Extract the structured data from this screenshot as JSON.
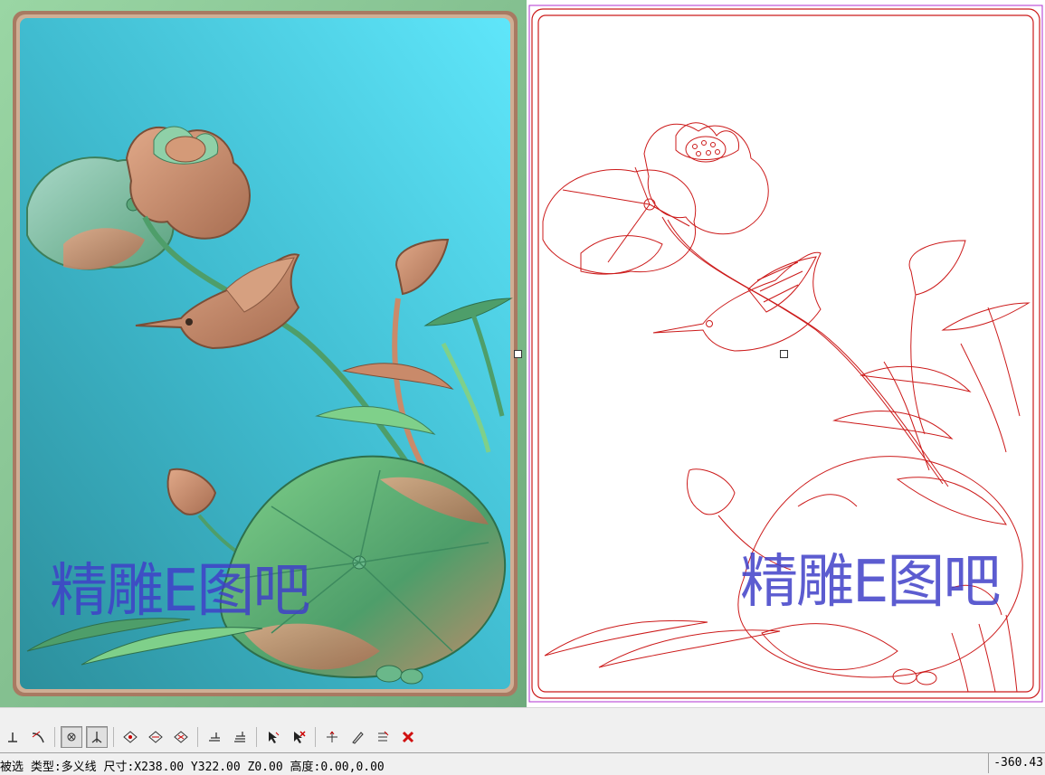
{
  "watermark": {
    "left_text": "精雕E图吧",
    "right_text": "精雕E图吧"
  },
  "colors": {
    "relief_frame": "#8fc89a",
    "relief_background_top": "#5fe0f8",
    "relief_background_bottom": "#2f9aa6",
    "copper": "#c98a6a",
    "jade_green": "#4fa06a",
    "vector_lines": "#cc1a1a",
    "selection_outline": "#b030d0",
    "watermark": "#4040c8"
  },
  "toolbar": {
    "buttons": [
      {
        "icon": "perpendicular-snap-icon"
      },
      {
        "icon": "tangent-snap-icon"
      },
      {
        "icon": "snap-toggle-icon",
        "pressed": true
      },
      {
        "icon": "ortho-toggle-icon",
        "pressed": true
      },
      {
        "icon": "diamond-node-icon"
      },
      {
        "icon": "diamond-node-alt-icon"
      },
      {
        "icon": "diamond-node-cross-icon"
      },
      {
        "icon": "layer-flat-icon"
      },
      {
        "icon": "layer-stack-icon"
      },
      {
        "icon": "select-arrow-icon"
      },
      {
        "icon": "deselect-arrow-icon"
      },
      {
        "icon": "transform-arrow-icon"
      },
      {
        "icon": "pick-pen-icon"
      },
      {
        "icon": "list-edit-icon"
      },
      {
        "icon": "delete-x-icon"
      }
    ]
  },
  "statusbar": {
    "text": "被选 类型:多义线 尺寸:X238.00 Y322.00 Z0.00 高度:0.00,0.00",
    "coordinate": "-360.43"
  }
}
